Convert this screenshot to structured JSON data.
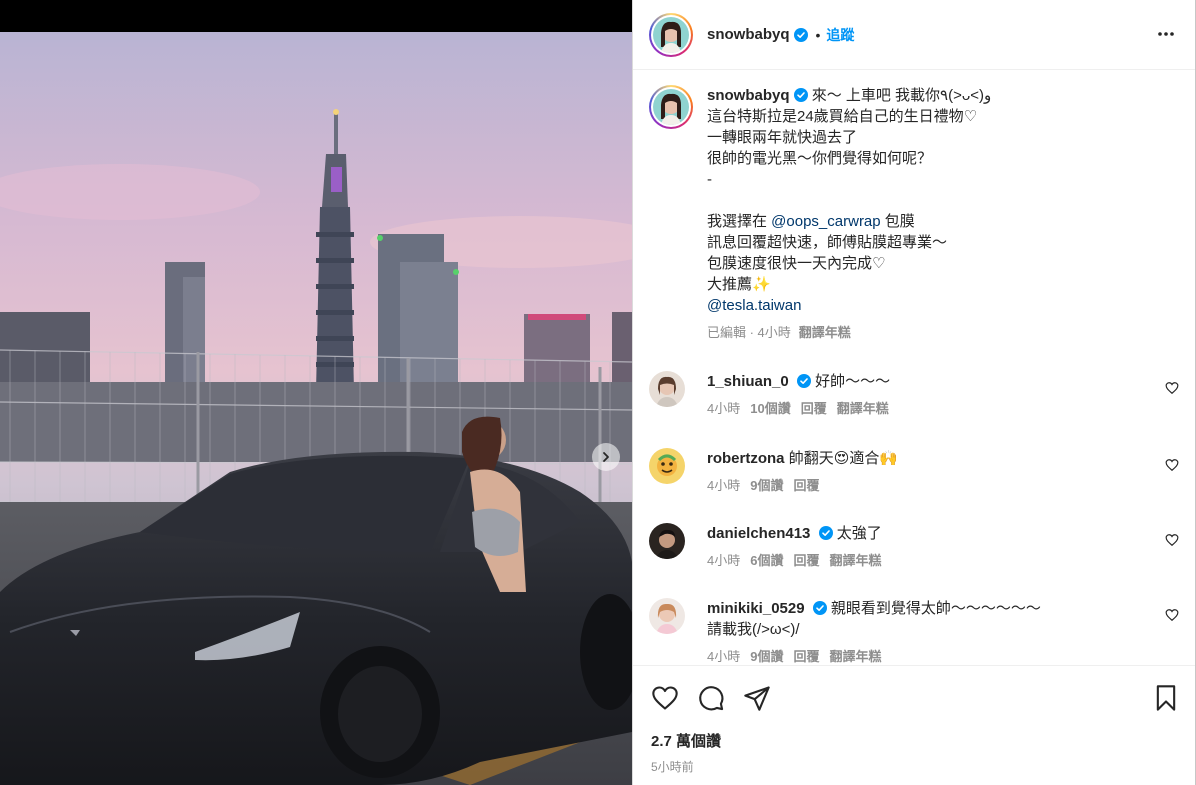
{
  "post": {
    "username": "snowbabyq",
    "dot": "•",
    "follow_label": "追蹤",
    "caption_lines": [
      "來～ 上車吧 我載你٩(>ᴗ<)و",
      "這台特斯拉是24歲買給自己的生日禮物♡",
      "一轉眼兩年就快過去了",
      "很帥的電光黑～你們覺得如何呢？",
      "-",
      "",
      "我選擇在 ",
      "訊息回覆超快速，師傅貼膜超專業～",
      "包膜速度很快一天內完成♡",
      "大推薦✨",
      ""
    ],
    "mention_carwrap": "@oops_carwrap",
    "after_carwrap": " 包膜",
    "mention_tesla": "@tesla.taiwan",
    "caption_meta": "已編輯 · 4小時",
    "translate_label": "翻譯年糕"
  },
  "comments": [
    {
      "user": "1_shiuan_0",
      "verified": true,
      "text": "好帥～～～",
      "text2": "",
      "time": "4小時",
      "likes": "10個讚",
      "reply": "回覆",
      "translate": "翻譯年糕"
    },
    {
      "user": "robertzona",
      "verified": false,
      "text": "帥翻天😍適合🙌",
      "text2": "",
      "time": "4小時",
      "likes": "9個讚",
      "reply": "回覆",
      "translate": ""
    },
    {
      "user": "danielchen413",
      "verified": true,
      "text": "太強了",
      "text2": "",
      "time": "4小時",
      "likes": "6個讚",
      "reply": "回覆",
      "translate": "翻譯年糕"
    },
    {
      "user": "minikiki_0529",
      "verified": true,
      "text": "親眼看到覺得太帥～～～～～～",
      "text2": "請載我(/>ω<)/",
      "time": "4小時",
      "likes": "9個讚",
      "reply": "回覆",
      "translate": "翻譯年糕"
    }
  ],
  "footer": {
    "likes": "2.7 萬個讚",
    "time": "5小時前"
  },
  "icons": {
    "like": "heart-icon",
    "comment": "comment-icon",
    "share": "paper-plane-icon",
    "save": "bookmark-icon",
    "more": "more-horizontal-icon",
    "next": "chevron-right-icon",
    "verified": "verified-badge-icon"
  },
  "colors": {
    "accent": "#0095f6",
    "link": "#00376b",
    "muted": "#8e8e8e",
    "text": "#262626"
  }
}
